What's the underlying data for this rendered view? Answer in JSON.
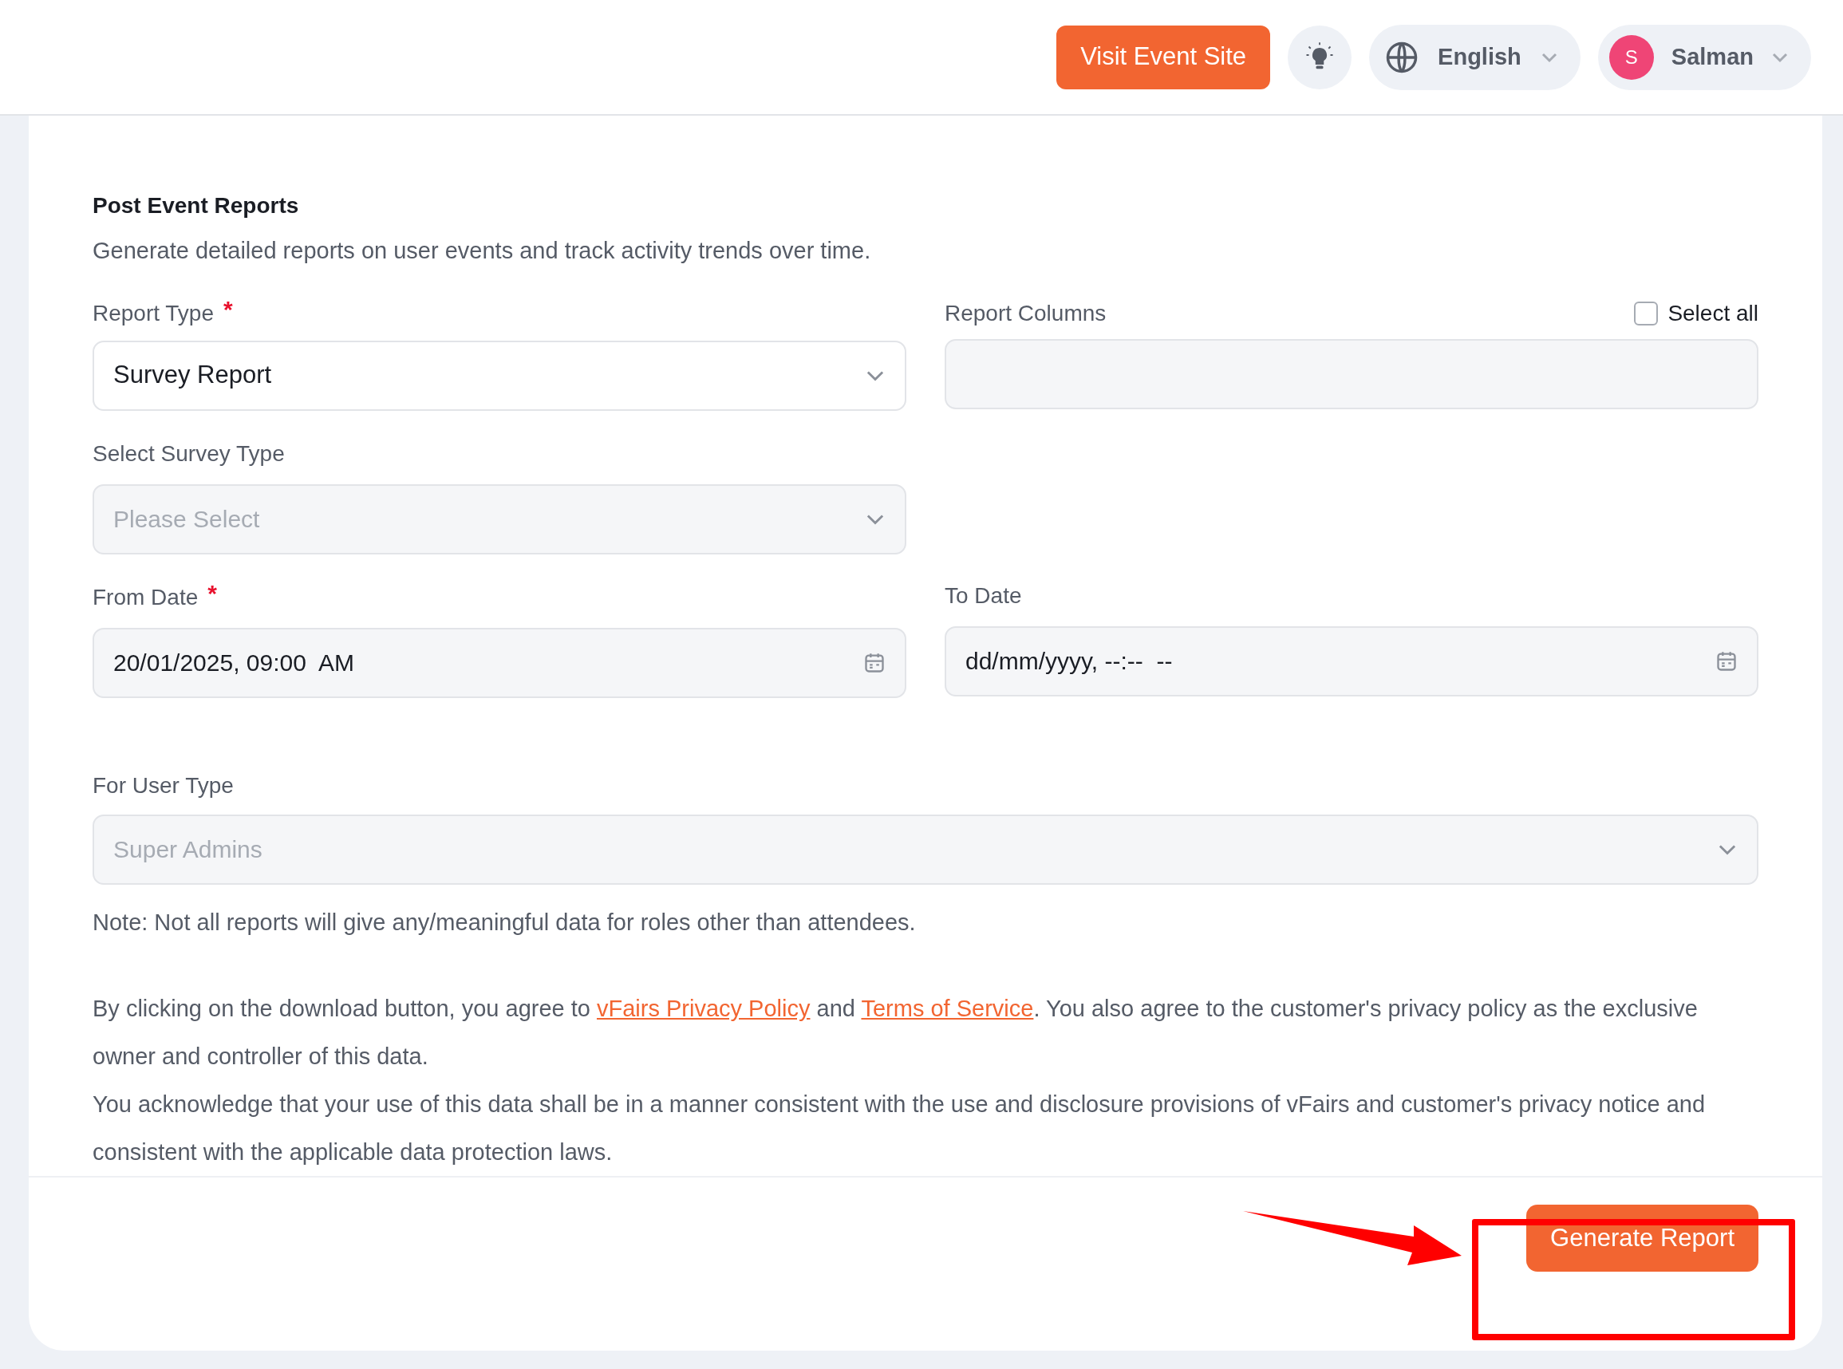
{
  "header": {
    "visit_button": "Visit Event Site",
    "language": "English",
    "user": {
      "initial": "S",
      "name": "Salman"
    }
  },
  "form": {
    "title": "Post Event Reports",
    "subtitle": "Generate detailed reports on user events and track activity trends over time.",
    "report_type": {
      "label": "Report Type",
      "required_mark": "*",
      "value": "Survey Report"
    },
    "report_columns": {
      "label": "Report Columns",
      "select_all": {
        "label": "Select all",
        "checked": false
      }
    },
    "survey_type": {
      "label": "Select Survey Type",
      "placeholder": "Please Select"
    },
    "from_date": {
      "label": "From Date",
      "required_mark": "*",
      "value": "20/01/2025, 09:00  AM"
    },
    "to_date": {
      "label": "To Date",
      "placeholder": "dd/mm/yyyy, --:--  --"
    },
    "user_type": {
      "label": "For User Type",
      "placeholder": "Super Admins"
    },
    "note": "Note: Not all reports will give any/meaningful data for roles other than attendees.",
    "consent": [
      {
        "kind": "text",
        "text": "By clicking on the download button, you agree to "
      },
      {
        "kind": "link",
        "text": "vFairs Privacy Policy"
      },
      {
        "kind": "text",
        "text": " and "
      },
      {
        "kind": "link",
        "text": "Terms of Service"
      },
      {
        "kind": "text",
        "text": ". You also agree to the customer's privacy policy as the exclusive owner and controller of this data."
      }
    ],
    "acknowledgement": "You acknowledge that your use of this data shall be in a manner consistent with the use and disclosure provisions of vFairs and customer's privacy notice and consistent with the applicable data protection laws.",
    "generate_button": "Generate Report"
  }
}
